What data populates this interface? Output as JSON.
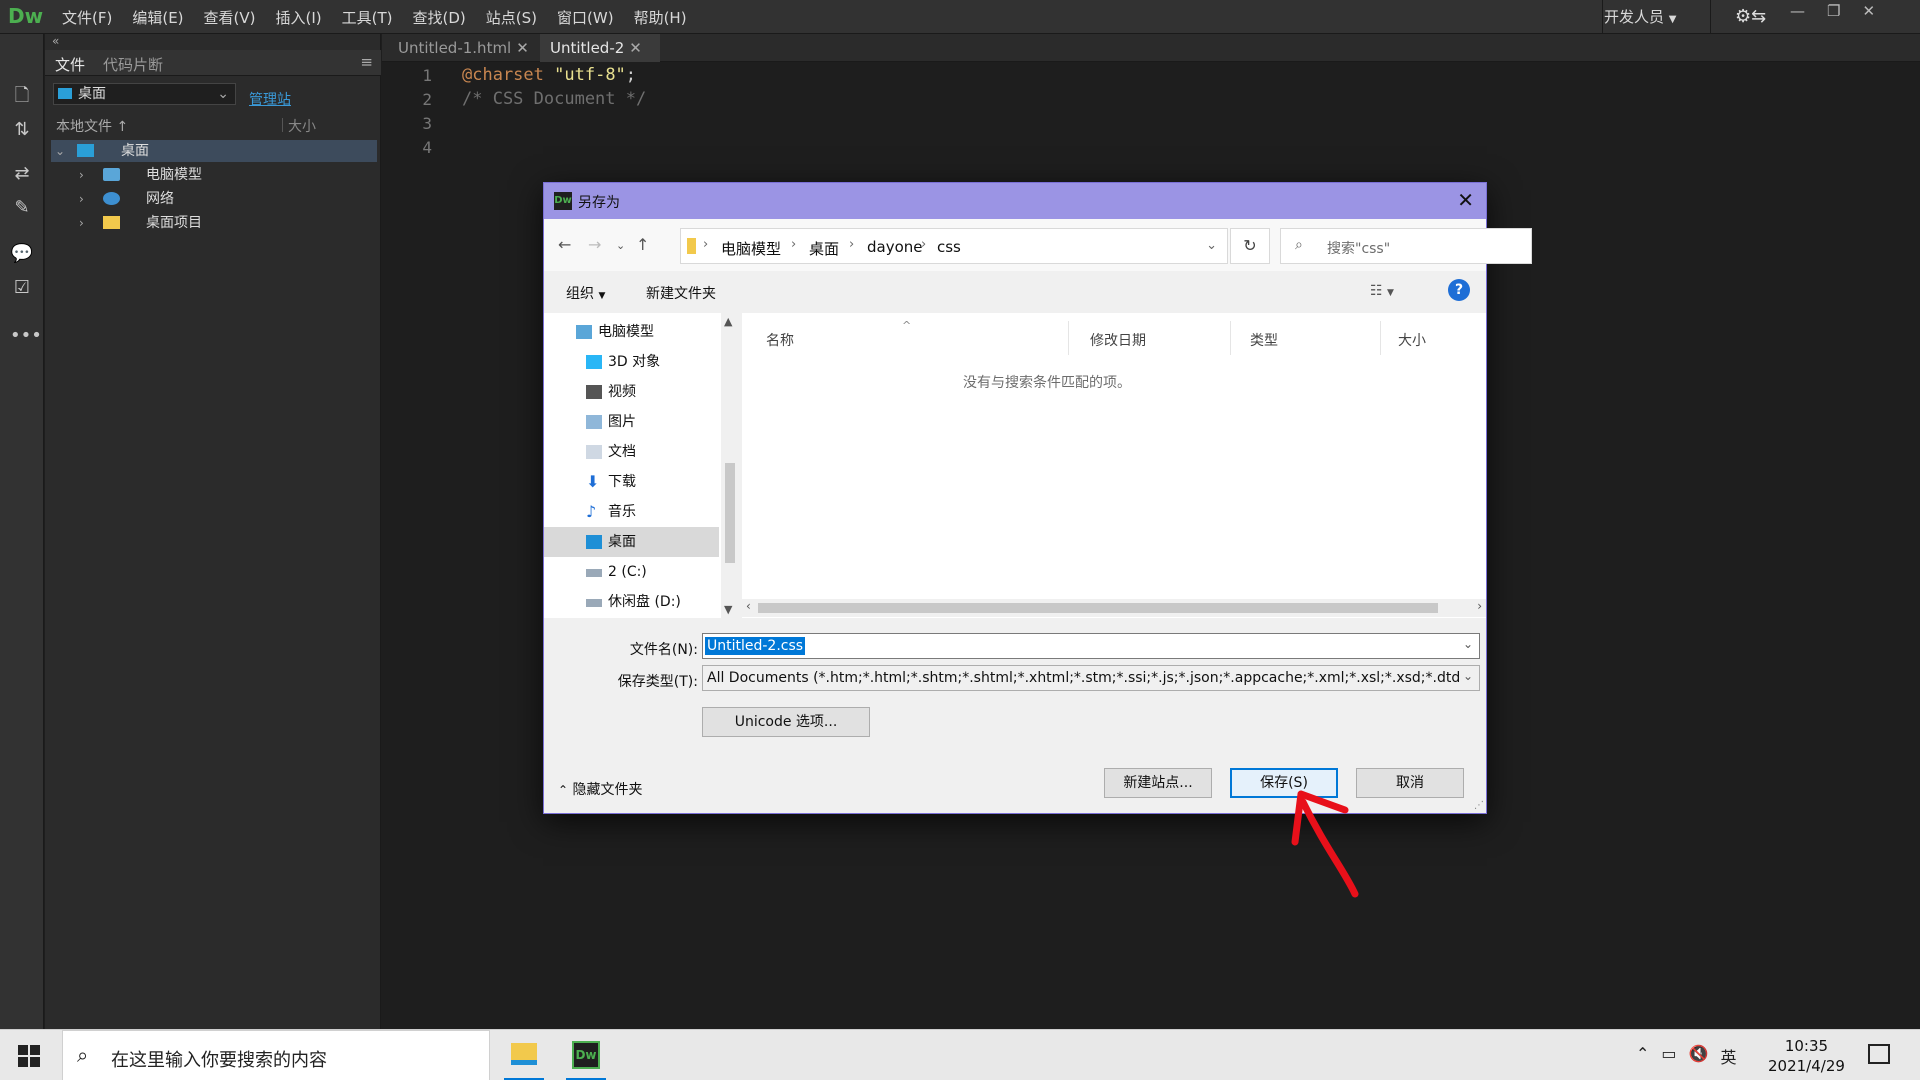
{
  "app": {
    "logo": "Dw",
    "menu": [
      "文件(F)",
      "编辑(E)",
      "查看(V)",
      "插入(I)",
      "工具(T)",
      "查找(D)",
      "站点(S)",
      "窗口(W)",
      "帮助(H)"
    ],
    "workspace": "开发人员"
  },
  "files_panel": {
    "tab_files": "文件",
    "tab_snippets": "代码片断",
    "site_select": "桌面",
    "manage_site": "管理站",
    "col_local": "本地文件",
    "col_size": "大小",
    "tree": [
      {
        "label": "桌面",
        "icon": "desktop-icon"
      },
      {
        "label": "电脑模型",
        "icon": "computer-icon"
      },
      {
        "label": "网络",
        "icon": "network-icon"
      },
      {
        "label": "桌面项目",
        "icon": "folder-icon"
      }
    ]
  },
  "editor": {
    "tabs": [
      {
        "label": "Untitled-1.html"
      },
      {
        "label": "Untitled-2"
      }
    ],
    "lines": [
      "1",
      "2",
      "3",
      "4"
    ],
    "code": {
      "l1_kw": "@charset",
      "l1_str": "\"utf-8\"",
      "l1_punc": ";",
      "l2_cmt": "/* CSS Document */"
    }
  },
  "dialog": {
    "title": "另存为",
    "path": [
      "电脑模型",
      "桌面",
      "dayone",
      "css"
    ],
    "search_placeholder": "搜索\"css\"",
    "organize": "组织",
    "new_folder": "新建文件夹",
    "nav_items": [
      {
        "label": "电脑模型",
        "icon": "computer-icon"
      },
      {
        "label": "3D 对象",
        "icon": "3d-objects-icon"
      },
      {
        "label": "视频",
        "icon": "video-icon"
      },
      {
        "label": "图片",
        "icon": "pictures-icon"
      },
      {
        "label": "文档",
        "icon": "documents-icon"
      },
      {
        "label": "下载",
        "icon": "download-icon"
      },
      {
        "label": "音乐",
        "icon": "music-icon"
      },
      {
        "label": "桌面",
        "icon": "desktop-icon"
      },
      {
        "label": "2 (C:)",
        "icon": "drive-icon"
      },
      {
        "label": "休闲盘 (D:)",
        "icon": "drive-icon"
      }
    ],
    "columns": [
      "名称",
      "修改日期",
      "类型",
      "大小"
    ],
    "empty_message": "没有与搜索条件匹配的项。",
    "filename_label": "文件名(N):",
    "filename_value": "Untitled-2.css",
    "filetype_label": "保存类型(T):",
    "filetype_value": "All Documents (*.htm;*.html;*.shtm;*.shtml;*.xhtml;*.stm;*.ssi;*.js;*.json;*.appcache;*.xml;*.xsl;*.xsd;*.dtd",
    "unicode_btn": "Unicode 选项...",
    "hide_folders": "隐藏文件夹",
    "new_site_btn": "新建站点...",
    "save_btn": "保存(S)",
    "cancel_btn": "取消"
  },
  "taskbar": {
    "search_placeholder": "在这里输入你要搜索的内容",
    "ime": "英",
    "time": "10:35",
    "date": "2021/4/29"
  },
  "colors": {
    "dialog_title": "#9b94e4",
    "accent": "#0078d7",
    "dw_green": "#4caf50",
    "annotation": "#e8101a"
  }
}
